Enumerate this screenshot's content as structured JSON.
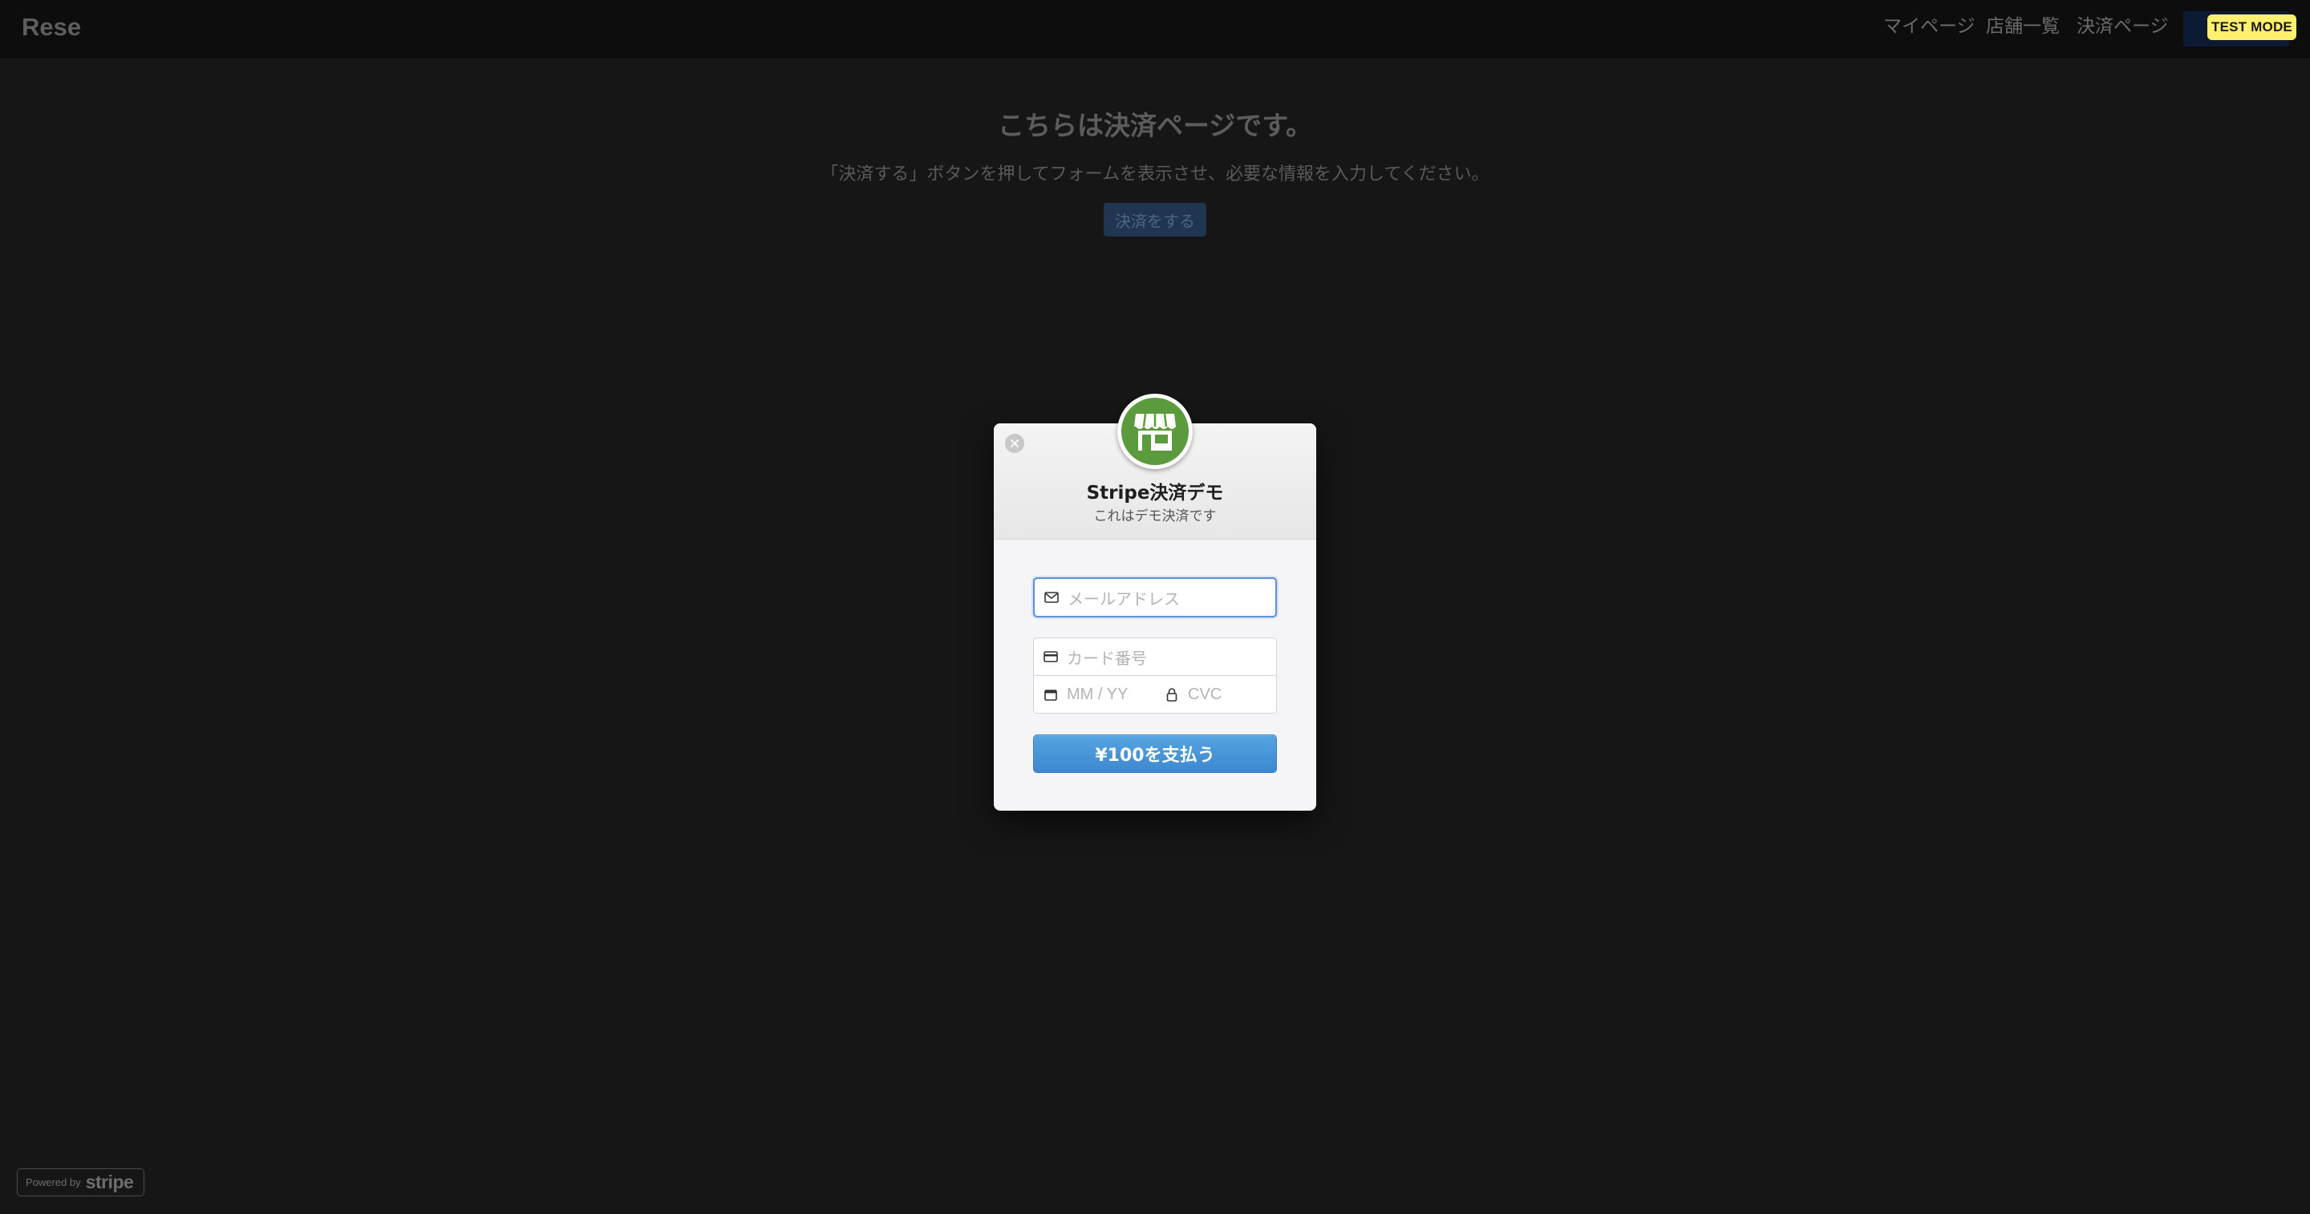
{
  "app": {
    "logo": "Rese"
  },
  "nav": {
    "items": [
      {
        "label": "マイページ"
      },
      {
        "label": "店舗一覧"
      },
      {
        "label": "決済ページ"
      }
    ]
  },
  "test_mode_badge": "TEST MODE",
  "page": {
    "title": "こちらは決済ページです。",
    "description": "「決済する」ボタンを押してフォームを表示させ、必要な情報を入力してください。",
    "pay_button": "決済をする"
  },
  "modal": {
    "store_name": "Stripe決済デモ",
    "store_description": "これはデモ決済です",
    "email": {
      "placeholder": "メールアドレス",
      "icon": "mail-icon"
    },
    "card_number": {
      "placeholder": "カード番号",
      "icon": "credit-card-icon"
    },
    "expiry": {
      "placeholder": "MM / YY",
      "icon": "calendar-icon"
    },
    "cvc": {
      "placeholder": "CVC",
      "icon": "lock-icon"
    },
    "submit_label": "¥100を支払う"
  },
  "powered_by": {
    "prefix": "Powered by",
    "brand": "stripe"
  },
  "colors": {
    "accent": "#4A98DB",
    "store_avatar": "#5C9A3E",
    "test_mode_badge": "#FFF070",
    "overlay_bg": "#161616"
  }
}
